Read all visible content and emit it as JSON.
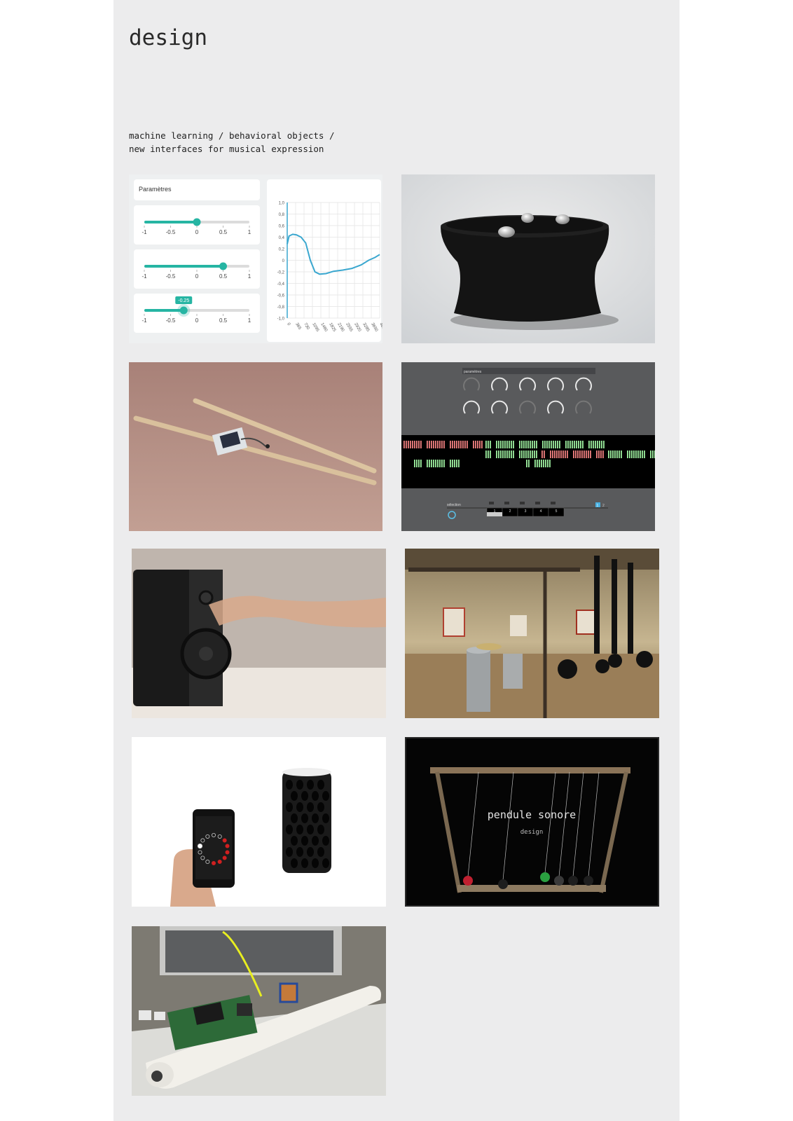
{
  "title": "design",
  "subtitle": {
    "line1": "machine learning / behavioral objects /",
    "line2": "new interfaces for musical expression"
  },
  "interface_panel": {
    "header": "Paramètres",
    "sliders": [
      {
        "ticks": [
          "-1",
          "-0.5",
          "0",
          "0.5",
          "1"
        ],
        "value": 0
      },
      {
        "ticks": [
          "-1",
          "-0.5",
          "0",
          "0.5",
          "1"
        ],
        "value": 0.5
      },
      {
        "ticks": [
          "-1",
          "-0.5",
          "0",
          "0.5",
          "1"
        ],
        "value": -0.25,
        "tooltip": "-0.25"
      }
    ],
    "graph": {
      "y_ticks": [
        "1,0",
        "0,8",
        "0,6",
        "0,4",
        "0,2",
        "0",
        "-0,2",
        "-0,4",
        "-0,6",
        "-0,8",
        "-1,0"
      ],
      "x_ticks": [
        "0",
        "365",
        "730",
        "1095",
        "1460",
        "1825",
        "2190",
        "2555",
        "2920",
        "3285",
        "3650",
        "4015"
      ],
      "line_color": "#3aa7cf"
    }
  },
  "software_panel": {
    "header": "paramètres",
    "selection_label": "sélection",
    "cells": [
      "1",
      "2",
      "3",
      "4",
      "5"
    ],
    "pager": [
      "1",
      "2"
    ]
  },
  "pendule": {
    "title": "pendule sonore",
    "subtitle": "design"
  },
  "tiles": [
    {
      "caption_icon": "interface-screenshot"
    },
    {
      "caption_icon": "black-object-with-spheres"
    },
    {
      "caption_icon": "drumsticks-with-sensor"
    },
    {
      "caption_icon": "software-knobs-sequencer"
    },
    {
      "caption_icon": "speaker-with-hand"
    },
    {
      "caption_icon": "installation-room"
    },
    {
      "caption_icon": "phone-app-and-speaker"
    },
    {
      "caption_icon": "pendule-sonore"
    },
    {
      "caption_icon": "electronics-tube"
    }
  ],
  "colors": {
    "page_bg": "#ececed",
    "accent_teal": "#26b5a3",
    "seq_red": "#f08080",
    "seq_green": "#9ef0a0"
  }
}
